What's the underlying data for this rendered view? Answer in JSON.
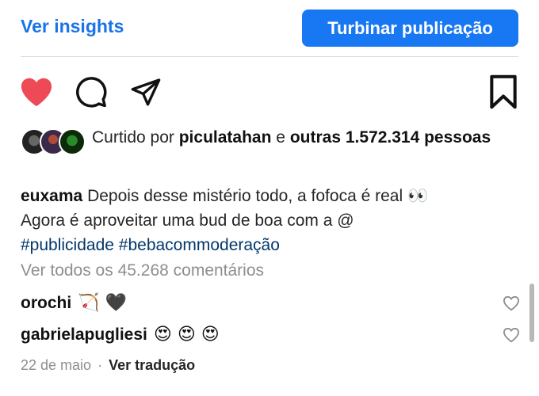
{
  "top_bar": {
    "insights_label": "Ver insights",
    "boost_label": "Turbinar publicação",
    "accent_color": "#1877f2"
  },
  "actions": {
    "icons": [
      "heart-icon",
      "comment-icon",
      "share-icon",
      "bookmark-icon"
    ],
    "liked": true,
    "heart_color": "#ed4956"
  },
  "likes": {
    "prefix": "Curtido por",
    "user": "piculatahan",
    "connector": "e",
    "others": "outras 1.572.314 pessoas"
  },
  "caption": {
    "user": "euxama",
    "line1": "Depois desse mistério todo, a fofoca é real 👀",
    "line2": "Agora é aproveitar uma bud de boa com a @",
    "hashtag1": "#publicidade",
    "hashtag2": "#bebacommoderação"
  },
  "view_comments": "Ver todos os 45.268 comentários",
  "comments": [
    {
      "user": "orochi",
      "text": "🏹 🖤"
    },
    {
      "user": "gabrielapugliesi",
      "text": "😍 😍 😍"
    }
  ],
  "footer": {
    "date": "22 de maio",
    "separator": "·",
    "translate": "Ver tradução"
  }
}
